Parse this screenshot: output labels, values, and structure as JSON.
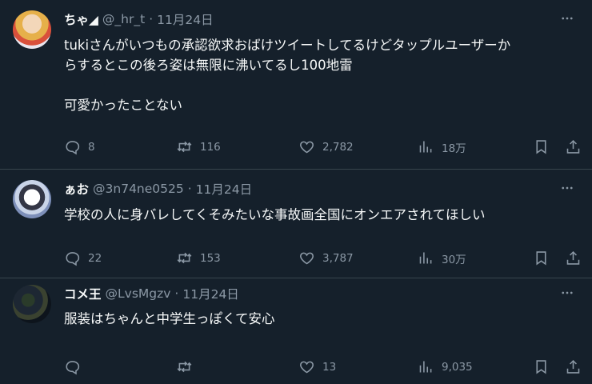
{
  "tweets": [
    {
      "name": "ちゃ◢",
      "handle": "@_hr_t",
      "dot": "·",
      "date": "11月24日",
      "lines": [
        "tukiさんがいつもの承認欲求おばけツイートしてるけどタップルユーザーか",
        "らするとこの後ろ姿は無限に沸いてるし100地雷",
        "",
        "可愛かったことない"
      ],
      "replies": "8",
      "retweets": "116",
      "likes": "2,782",
      "views": "18万"
    },
    {
      "name": "ぁお",
      "handle": "@3n74ne0525",
      "dot": "·",
      "date": "11月24日",
      "lines": [
        "学校の人に身バレしてくそみたいな事故画全国にオンエアされてほしい"
      ],
      "replies": "22",
      "retweets": "153",
      "likes": "3,787",
      "views": "30万"
    },
    {
      "name": "コメ王",
      "handle": "@LvsMgzv",
      "dot": "·",
      "date": "11月24日",
      "lines": [
        "服装はちゃんと中学生っぽくて安心"
      ],
      "replies": "",
      "retweets": "",
      "likes": "13",
      "views": "9,035"
    }
  ],
  "colors": {
    "background": "#15202b",
    "text": "#f7f9f9",
    "muted": "#8b98a5",
    "divider": "#38444d"
  },
  "icons": [
    "more-icon",
    "reply-icon",
    "retweet-icon",
    "like-icon",
    "views-icon",
    "bookmark-icon",
    "share-icon"
  ]
}
